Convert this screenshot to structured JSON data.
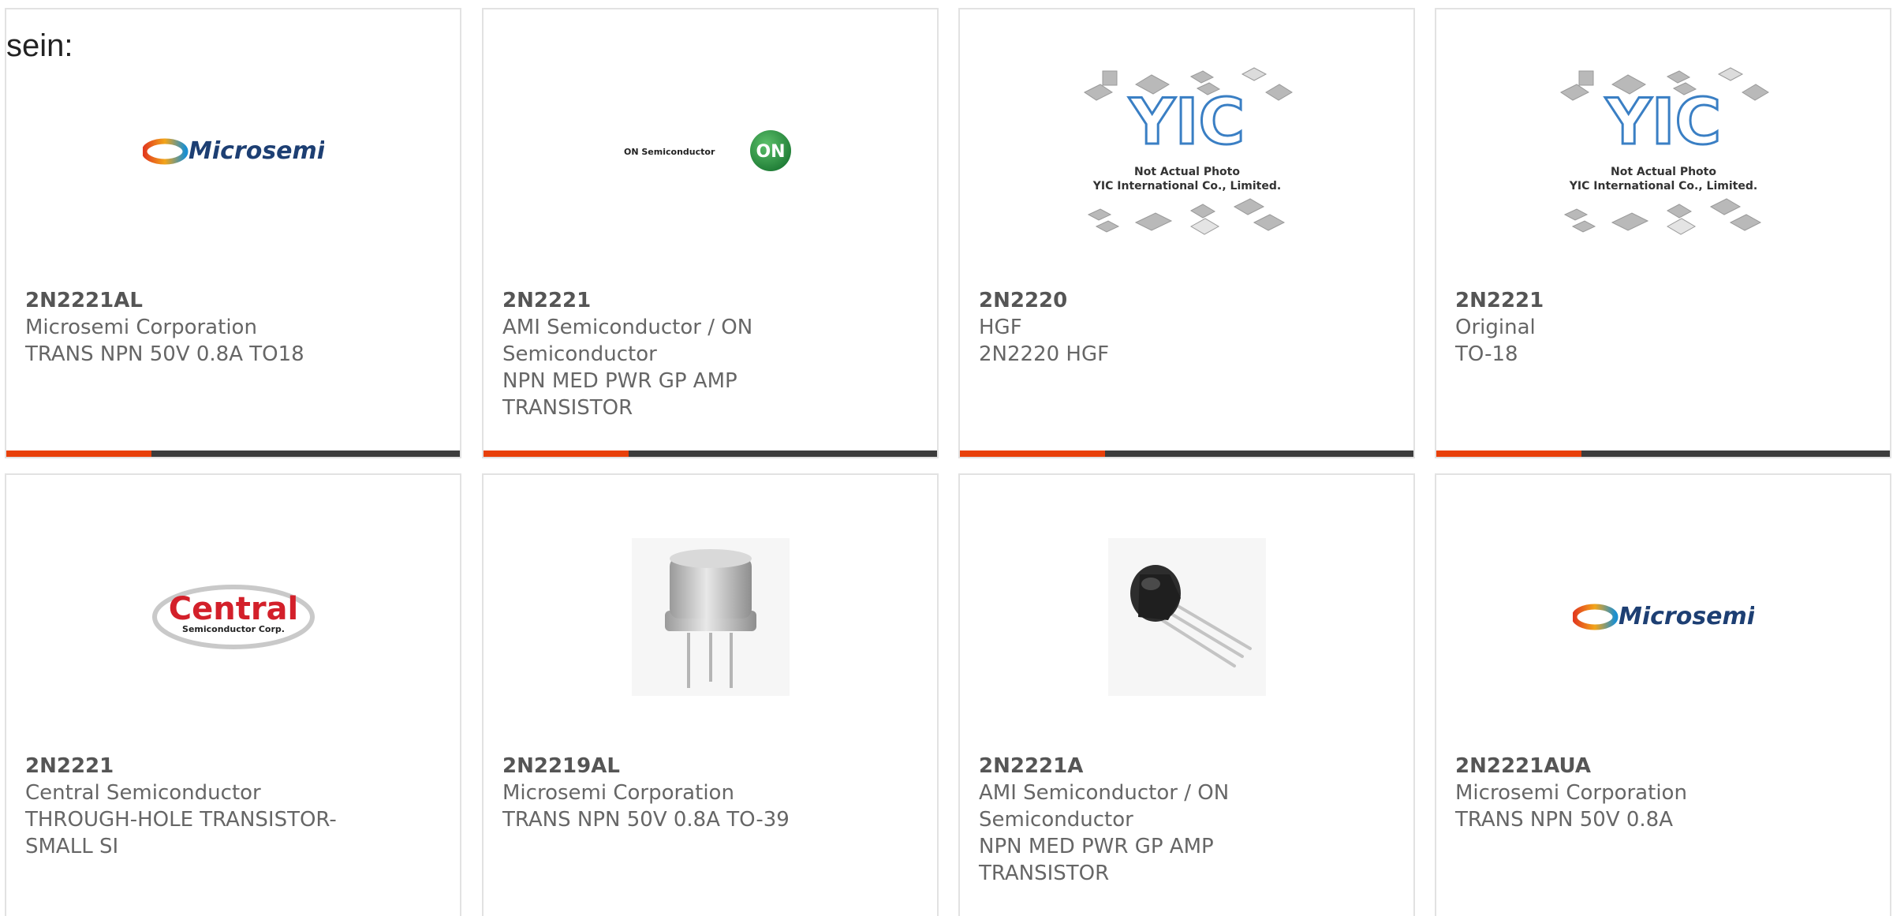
{
  "lead_text": "sein:",
  "accent_color": "#e8400a",
  "bar_color": "#3c3c3c",
  "cards": [
    {
      "part": "2N2221AL",
      "manufacturer": "Microsemi Corporation",
      "description": "TRANS NPN 50V 0.8A TO18",
      "image": "microsemi-logo",
      "logo_text": "Microsemi"
    },
    {
      "part": "2N2221",
      "manufacturer": "AMI Semiconductor / ON Semiconductor",
      "description": "NPN MED PWR GP AMP TRANSISTOR",
      "image": "on-semiconductor-logo",
      "logo_text": "ON Semiconductor",
      "logo_badge": "ON"
    },
    {
      "part": "2N2220",
      "manufacturer": "HGF",
      "description": "2N2220 HGF",
      "image": "yic-placeholder",
      "logo_text": "YIC",
      "caption1": "Not Actual Photo",
      "caption2": "YIC International Co., Limited."
    },
    {
      "part": "2N2221",
      "manufacturer": "Original",
      "description": "TO-18",
      "image": "yic-placeholder",
      "logo_text": "YIC",
      "caption1": "Not Actual Photo",
      "caption2": "YIC International Co., Limited."
    },
    {
      "part": "2N2221",
      "manufacturer": "Central Semiconductor",
      "description": "THROUGH-HOLE TRANSISTOR-SMALL SI",
      "image": "central-logo",
      "logo_text": "Central",
      "logo_sub": "Semiconductor Corp."
    },
    {
      "part": "2N2219AL",
      "manufacturer": "Microsemi Corporation",
      "description": "TRANS NPN 50V 0.8A TO-39",
      "image": "to39-transistor-photo"
    },
    {
      "part": "2N2221A",
      "manufacturer": "AMI Semiconductor / ON Semiconductor",
      "description": "NPN MED PWR GP AMP TRANSISTOR",
      "image": "to92-transistor-photo"
    },
    {
      "part": "2N2221AUA",
      "manufacturer": "Microsemi Corporation",
      "description": "TRANS NPN 50V 0.8A",
      "image": "microsemi-logo",
      "logo_text": "Microsemi"
    }
  ]
}
